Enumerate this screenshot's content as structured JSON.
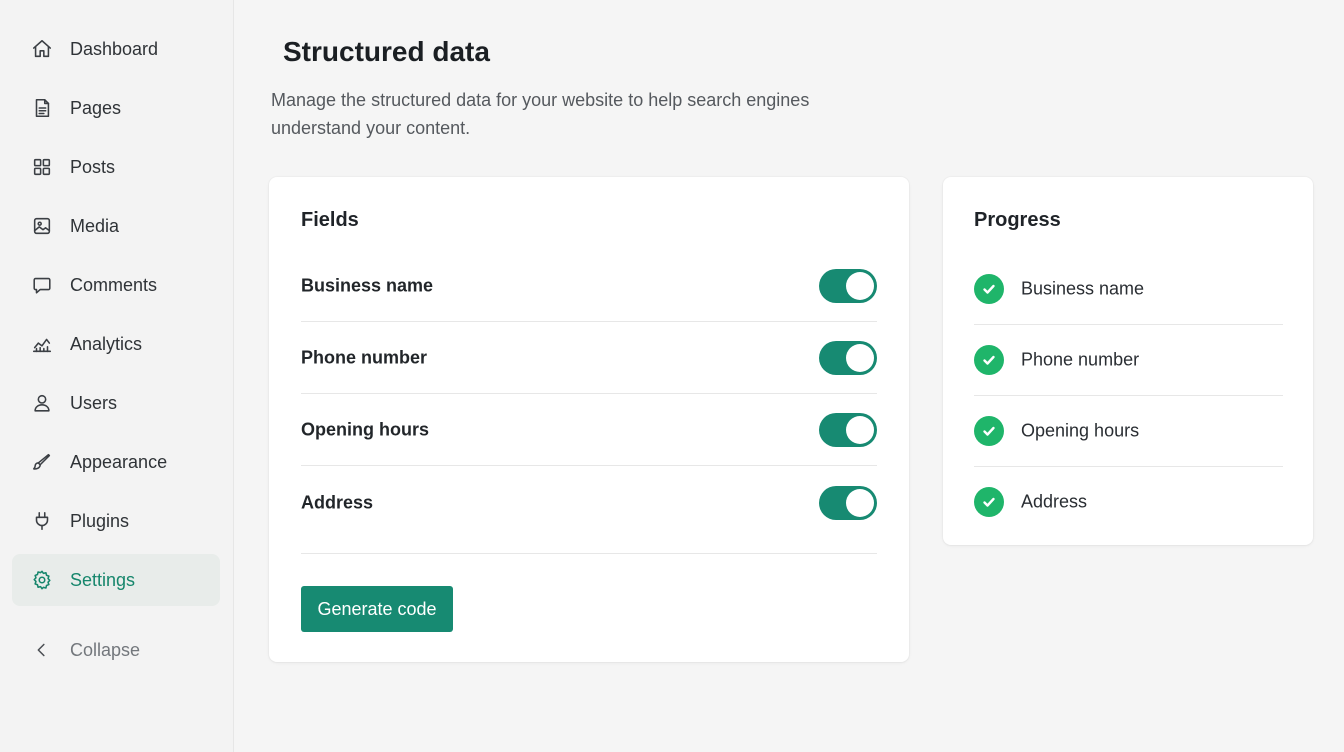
{
  "sidebar": {
    "items": [
      {
        "label": "Dashboard",
        "icon": "home-icon"
      },
      {
        "label": "Pages",
        "icon": "page-icon"
      },
      {
        "label": "Posts",
        "icon": "grid-icon"
      },
      {
        "label": "Media",
        "icon": "image-icon"
      },
      {
        "label": "Comments",
        "icon": "comment-icon"
      },
      {
        "label": "Analytics",
        "icon": "chart-icon"
      },
      {
        "label": "Users",
        "icon": "user-icon"
      },
      {
        "label": "Appearance",
        "icon": "brush-icon"
      },
      {
        "label": "Plugins",
        "icon": "plug-icon"
      },
      {
        "label": "Settings",
        "icon": "gear-icon",
        "active": true
      }
    ],
    "collapse_label": "Collapse",
    "collapse_icon": "chevron-left-icon"
  },
  "header": {
    "title": "Structured data",
    "description": "Manage the structured data for your website to help search engines understand your content."
  },
  "fields_card": {
    "title": "Fields",
    "fields": [
      {
        "label": "Business name",
        "enabled": true
      },
      {
        "label": "Phone number",
        "enabled": true
      },
      {
        "label": "Opening hours",
        "enabled": true
      },
      {
        "label": "Address",
        "enabled": true
      }
    ],
    "generate_button": "Generate code"
  },
  "progress_card": {
    "title": "Progress",
    "items": [
      {
        "label": "Business name",
        "status": "complete"
      },
      {
        "label": "Phone number",
        "status": "complete"
      },
      {
        "label": "Opening hours",
        "status": "complete"
      },
      {
        "label": "Address",
        "status": "complete"
      }
    ]
  },
  "colors": {
    "accent": "#178a72",
    "success": "#1fb56a",
    "active_bg": "#e8ecea",
    "background": "#f5f5f5"
  }
}
